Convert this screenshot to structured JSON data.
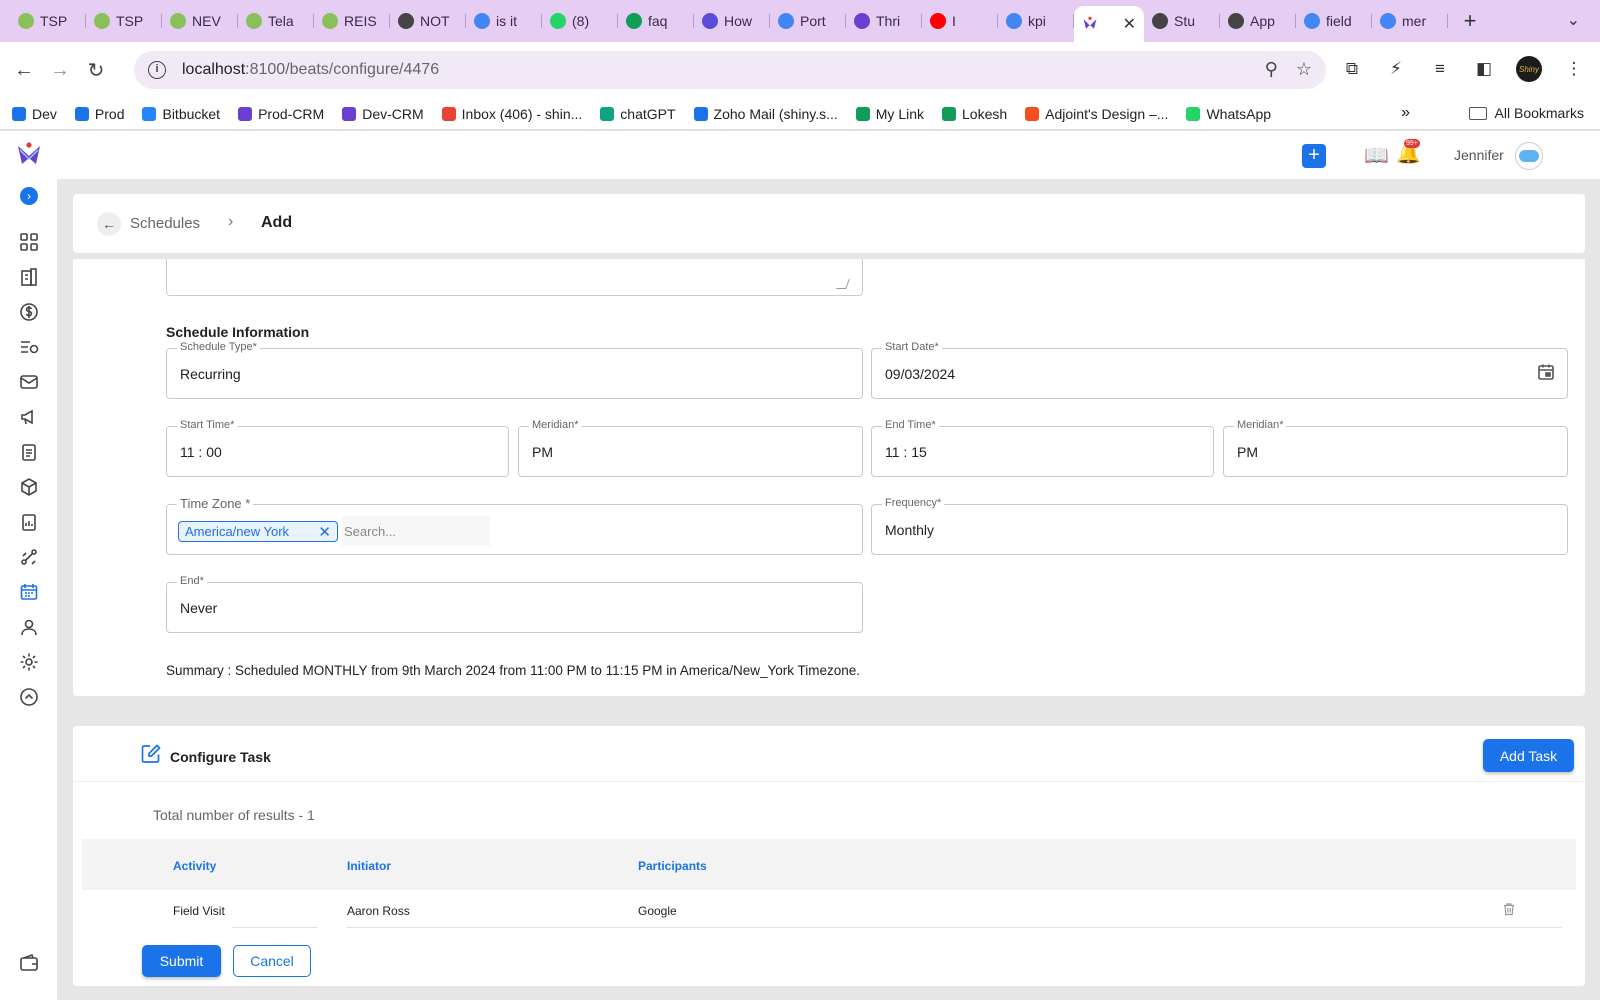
{
  "browser": {
    "tabs": [
      {
        "title": "TSP",
        "color": "#8bbf5a"
      },
      {
        "title": "TSP",
        "color": "#8bbf5a"
      },
      {
        "title": "NEV",
        "color": "#8bbf5a"
      },
      {
        "title": "Tela",
        "color": "#8bbf5a"
      },
      {
        "title": "REIS",
        "color": "#8bbf5a"
      },
      {
        "title": "NOT",
        "color": "#444444"
      },
      {
        "title": "is it",
        "color": "#4285f4"
      },
      {
        "title": "(8)",
        "color": "#25d366"
      },
      {
        "title": "faq",
        "color": "#0f9d58"
      },
      {
        "title": "How",
        "color": "#5b4bdb"
      },
      {
        "title": "Port",
        "color": "#4285f4"
      },
      {
        "title": "Thri",
        "color": "#6a3fd1"
      },
      {
        "title": "I",
        "color": "#ff0000"
      },
      {
        "title": "kpi",
        "color": "#4285f4"
      },
      {
        "title": "Stu",
        "color": "#444444"
      },
      {
        "title": "App",
        "color": "#444444"
      },
      {
        "title": "field",
        "color": "#4285f4"
      },
      {
        "title": "mer",
        "color": "#4285f4"
      }
    ],
    "url_host": "localhost",
    "url_path": ":8100/beats/configure/4476",
    "bookmarks": [
      {
        "label": "Dev",
        "color": "#1a73e8"
      },
      {
        "label": "Prod",
        "color": "#1a73e8"
      },
      {
        "label": "Bitbucket",
        "color": "#2684ff"
      },
      {
        "label": "Prod-CRM",
        "color": "#6a3fd1"
      },
      {
        "label": "Dev-CRM",
        "color": "#6a3fd1"
      },
      {
        "label": "Inbox (406) - shin...",
        "color": "#ea4335"
      },
      {
        "label": "chatGPT",
        "color": "#10a37f"
      },
      {
        "label": "Zoho Mail (shiny.s...",
        "color": "#1a73e8"
      },
      {
        "label": "My Link",
        "color": "#0f9d58"
      },
      {
        "label": "Lokesh",
        "color": "#0f9d58"
      },
      {
        "label": "Adjoint's Design –...",
        "color": "#f24e1e"
      },
      {
        "label": "WhatsApp",
        "color": "#25d366"
      }
    ],
    "all_bookmarks": "All Bookmarks"
  },
  "header": {
    "user": "Jennifer",
    "notif_badge": "99+",
    "accent": "#1a73e8"
  },
  "breadcrumb": {
    "parent": "Schedules",
    "current": "Add"
  },
  "schedule": {
    "section_title": "Schedule Information",
    "schedule_type": {
      "label": "Schedule Type",
      "value": "Recurring"
    },
    "start_date": {
      "label": "Start Date",
      "value": "09/03/2024"
    },
    "start_time": {
      "label": "Start Time",
      "value": "11 : 00"
    },
    "start_meridian": {
      "label": "Meridian",
      "value": "PM"
    },
    "end_time": {
      "label": "End Time",
      "value": "11 : 15"
    },
    "end_meridian": {
      "label": "Meridian",
      "value": "PM"
    },
    "time_zone": {
      "label": "Time Zone",
      "chip": "America/new York",
      "placeholder": "Search..."
    },
    "frequency": {
      "label": "Frequency",
      "value": "Monthly"
    },
    "end": {
      "label": "End",
      "value": "Never"
    },
    "summary": "Summary : Scheduled MONTHLY from 9th March 2024 from 11:00 PM to 11:15 PM in America/New_York Timezone."
  },
  "tasks": {
    "title": "Configure Task",
    "add_label": "Add Task",
    "total": "Total number of results - 1",
    "columns": [
      "Activity",
      "Initiator",
      "Participants"
    ],
    "rows": [
      {
        "activity": "Field Visit",
        "initiator": "Aaron Ross",
        "participants": "Google"
      }
    ]
  },
  "actions": {
    "submit": "Submit",
    "cancel": "Cancel"
  }
}
